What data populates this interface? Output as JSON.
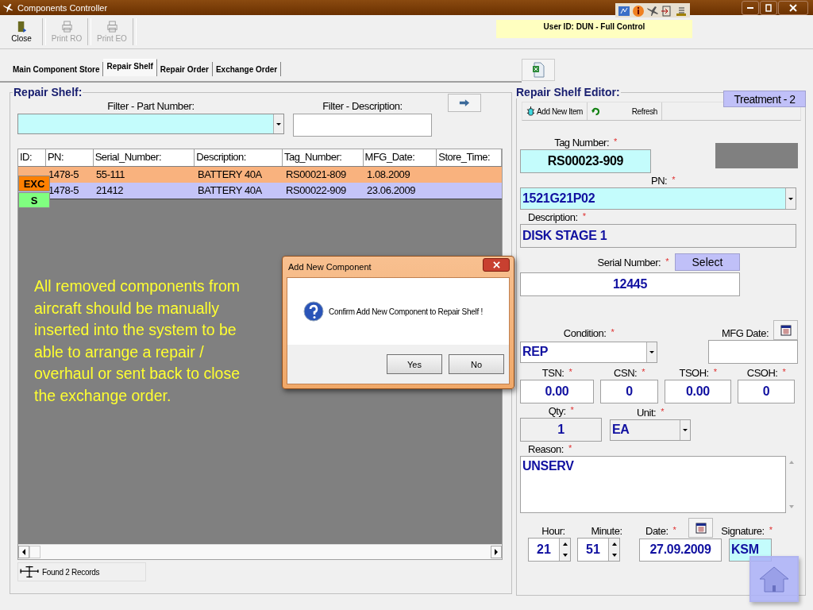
{
  "window": {
    "title": "Components Controller"
  },
  "toolbar": [
    {
      "label": "Close",
      "disabled": false,
      "kind": "exit"
    },
    {
      "label": "Print RO",
      "disabled": true,
      "kind": "print"
    },
    {
      "label": "Print EO",
      "disabled": true,
      "kind": "print"
    }
  ],
  "user_status": "User ID: DUN - Full Control",
  "tabs": [
    {
      "label": "Main Component Store",
      "selected": false
    },
    {
      "label": "Repair Shelf",
      "selected": true
    },
    {
      "label": "Repair Order",
      "selected": false
    },
    {
      "label": "Exchange Order",
      "selected": false
    }
  ],
  "repair_shelf": {
    "title": "Repair Shelf:",
    "filter_part_label": "Filter - Part Number:",
    "filter_description_label": "Filter - Description:",
    "table": {
      "columns": [
        "ID:",
        "PN:",
        "Serial_Number:",
        "Description:",
        "Tag_Number:",
        "MFG_Date:",
        "Store_Time:"
      ],
      "rows": [
        {
          "color": "#f9b27e",
          "pn": "1478-5",
          "serial": "55-111",
          "description": "BATTERY 40A",
          "tag": "RS00021-809",
          "mfg_date": "1.08.2009"
        },
        {
          "color": "#c4c4f8",
          "pn": "1478-5",
          "serial": "21412",
          "description": "BATTERY 40A",
          "tag": "RS00022-909",
          "mfg_date": "23.06.2009"
        }
      ],
      "badges": [
        {
          "label": "EXC",
          "color": "#ff8000"
        },
        {
          "label": "S",
          "color": "#80ff80"
        }
      ]
    },
    "annotation": "All removed components from aircraft should be manually inserted into the system to be able to arrange a repair / overhaul or sent back to close the exchange order.",
    "status": "Found 2 Records"
  },
  "dialog": {
    "title": "Add New Component",
    "message": "Confirm Add New Component to Repair Shelf !",
    "buttons": [
      "Yes",
      "No"
    ]
  },
  "editor": {
    "title": "Repair Shelf Editor:",
    "treatment": "Treatment - 2",
    "actions": [
      "Add New Item",
      "Refresh"
    ],
    "tag_number": {
      "label": "Tag Number:",
      "mark": "*",
      "value": "RS00023-909"
    },
    "pn": {
      "label": "PN:",
      "mark": "*",
      "value": "1521G21P02"
    },
    "description": {
      "label": "Description:",
      "mark": "*",
      "value": "DISK STAGE 1"
    },
    "serial_number": {
      "label": "Serial Number:",
      "mark": "*",
      "button": "Select",
      "value": "12445"
    },
    "condition": {
      "label": "Condition:",
      "mark": "*",
      "value": "REP"
    },
    "mfg_date": {
      "label": "MFG Date:"
    },
    "counters": [
      {
        "label": "TSN:",
        "mark": "*",
        "value": "0.00"
      },
      {
        "label": "CSN:",
        "mark": "*",
        "value": "0"
      },
      {
        "label": "TSOH:",
        "mark": "*",
        "value": "0.00"
      },
      {
        "label": "CSOH:",
        "mark": "*",
        "value": "0"
      }
    ],
    "qty": {
      "label": "Qty:",
      "mark": "*",
      "value": "1"
    },
    "unit": {
      "label": "Unit:",
      "mark": "*",
      "value": "EA"
    },
    "reason": {
      "label": "Reason:",
      "mark": "*",
      "value": "UNSERV"
    },
    "hour": {
      "label": "Hour:",
      "value": "21"
    },
    "minute": {
      "label": "Minute:",
      "value": "51"
    },
    "date": {
      "label": "Date:",
      "mark": "*",
      "value": "27.09.2009"
    },
    "signature": {
      "label": "Signature:",
      "mark": "*",
      "value": "KSM"
    }
  }
}
